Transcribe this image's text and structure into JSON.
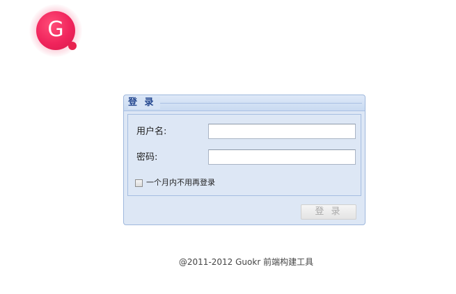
{
  "logo": {
    "letter": "G",
    "icon": "guokr-logo-icon",
    "color": "#f0245c"
  },
  "login": {
    "title": "登 录",
    "username_label": "用户名:",
    "username_value": "",
    "password_label": "密码:",
    "password_value": "",
    "remember_label": "一个月内不用再登录",
    "remember_checked": false,
    "submit_label": "登 录",
    "submit_enabled": false
  },
  "footer": {
    "text": "@2011-2012 Guokr 前端构建工具"
  },
  "colors": {
    "panel_bg": "#dde7f5",
    "panel_border": "#9fb8dd",
    "title": "#24478f"
  }
}
